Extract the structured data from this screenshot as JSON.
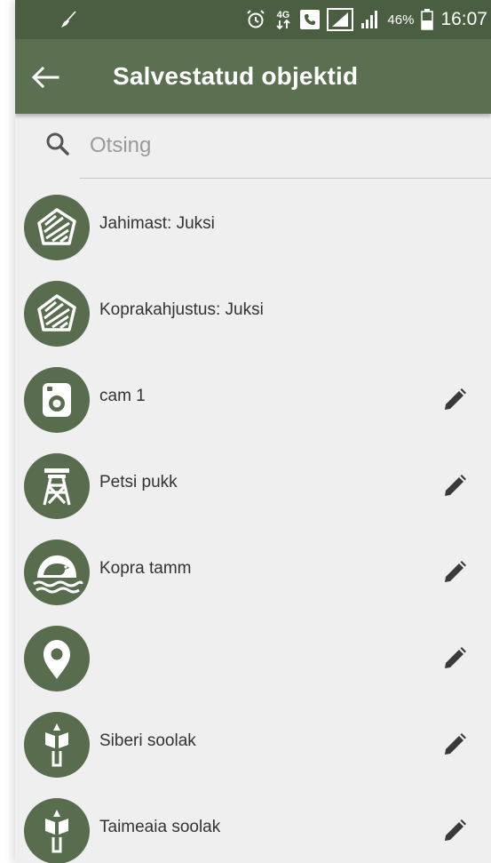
{
  "status_bar": {
    "battery_percent": "46%",
    "time": "16:07",
    "network_label": "4G",
    "icons": [
      "broom-icon",
      "alarm-icon",
      "network-4g-icon",
      "phone-icon",
      "signal-icon",
      "signal-icon",
      "battery-icon"
    ]
  },
  "app_bar": {
    "title": "Salvestatud objektid",
    "back_icon": "arrow-left-icon",
    "background": "#5a7050"
  },
  "search": {
    "placeholder": "Otsing",
    "value": ""
  },
  "items": [
    {
      "label": "Jahimast: Juksi",
      "icon": "hunting-area-icon",
      "editable": false
    },
    {
      "label": "Koprakahjustus: Juksi",
      "icon": "beaver-damage-icon",
      "editable": false
    },
    {
      "label": "cam 1",
      "icon": "camera-icon",
      "editable": true
    },
    {
      "label": "Petsi pukk",
      "icon": "hunting-tower-icon",
      "editable": true
    },
    {
      "label": "Kopra tamm",
      "icon": "beaver-dam-icon",
      "editable": true
    },
    {
      "label": "",
      "icon": "map-pin-icon",
      "editable": true
    },
    {
      "label": "Siberi soolak",
      "icon": "salt-lick-icon",
      "editable": true
    },
    {
      "label": "Taimeaia soolak",
      "icon": "salt-lick-icon",
      "editable": true
    }
  ],
  "colors": {
    "status_bar": "#4a5e42",
    "app_bar": "#5a7050",
    "icon_circle": "#576d4e",
    "background": "#efefef",
    "edit_icon": "#3a3a3a"
  }
}
